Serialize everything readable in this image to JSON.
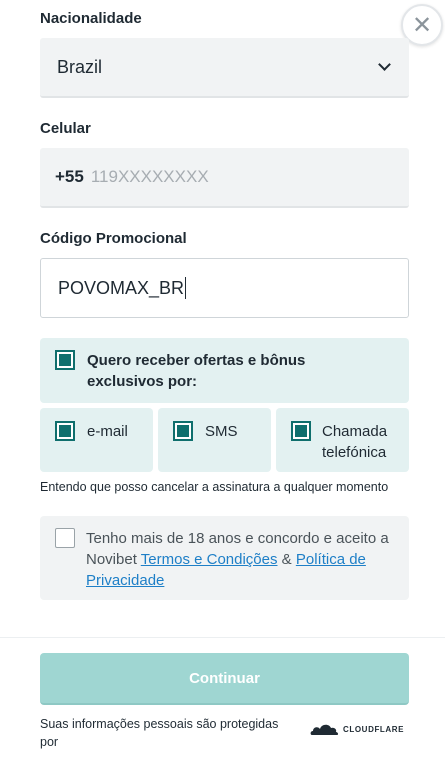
{
  "close": {
    "icon": "close-icon",
    "glyph": "✕"
  },
  "nationality": {
    "label": "Nacionalidade",
    "value": "Brazil"
  },
  "phone": {
    "label": "Celular",
    "prefix": "+55",
    "placeholder": "119XXXXXXXX"
  },
  "promo": {
    "label": "Código Promocional",
    "value": "POVOMAX_BR"
  },
  "offers": {
    "title": "Quero receber ofertas e bônus exclusivos por:",
    "title_checked": true,
    "options": [
      {
        "label": "e-mail",
        "checked": true
      },
      {
        "label": "SMS",
        "checked": true
      },
      {
        "label": "Chamada telefónica",
        "checked": true
      }
    ],
    "note": "Entendo que posso cancelar a assinatura a qualquer momento"
  },
  "terms": {
    "checked": false,
    "text_before": "Tenho mais de 18 anos e concordo e aceito a Novibet ",
    "link_terms": "Termos e Condições",
    "text_between": " & ",
    "link_privacy": "Política de Privacidade"
  },
  "continue_label": "Continuar",
  "footer": {
    "text": "Suas informações pessoais são protegidas por",
    "brand": "CLOUDFLARE"
  },
  "colors": {
    "teal": "#0f6f6d",
    "teal_bg": "#e3f1f1",
    "button": "#9fd6d2",
    "link": "#1e7fc7"
  }
}
